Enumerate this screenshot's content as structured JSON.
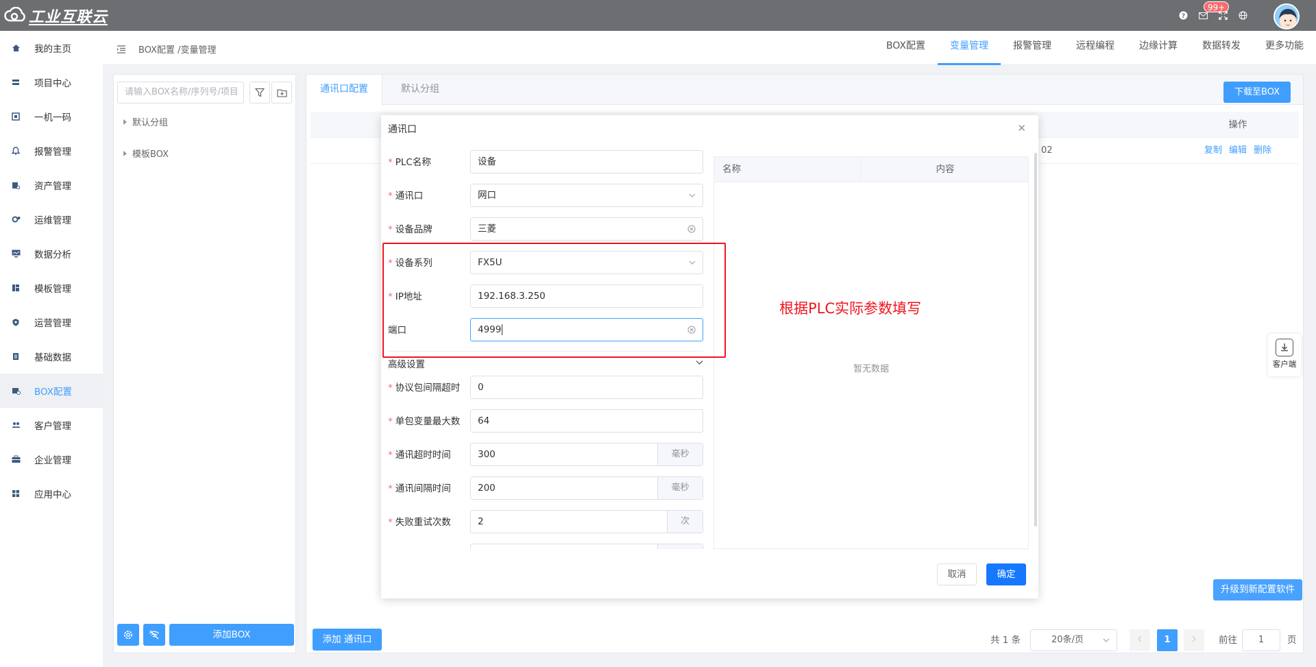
{
  "topbar": {
    "brand": "工业互联云",
    "badge": "99+"
  },
  "sidebar": {
    "items": [
      {
        "label": "我的主页",
        "icon": "home-icon"
      },
      {
        "label": "项目中心",
        "icon": "stack-icon"
      },
      {
        "label": "一机一码",
        "icon": "qr-icon"
      },
      {
        "label": "报警管理",
        "icon": "bell-icon"
      },
      {
        "label": "资产管理",
        "icon": "asset-icon"
      },
      {
        "label": "运维管理",
        "icon": "gear-icon"
      },
      {
        "label": "数据分析",
        "icon": "monitor-icon"
      },
      {
        "label": "模板管理",
        "icon": "template-icon"
      },
      {
        "label": "运营管理",
        "icon": "shield-icon"
      },
      {
        "label": "基础数据",
        "icon": "book-icon"
      },
      {
        "label": "BOX配置",
        "icon": "box-icon"
      },
      {
        "label": "客户管理",
        "icon": "users-icon"
      },
      {
        "label": "企业管理",
        "icon": "briefcase-icon"
      },
      {
        "label": "应用中心",
        "icon": "apps-icon"
      }
    ],
    "active_index": 10
  },
  "header": {
    "breadcrumb": "BOX配置 /变量管理",
    "tabs": [
      "BOX配置",
      "变量管理",
      "报警管理",
      "远程编程",
      "边缘计算",
      "数据转发",
      "更多功能"
    ],
    "active_tab": 1
  },
  "leftpanel": {
    "search_placeholder": "请输入BOX名称/序列号/项目",
    "tree": [
      "默认分组",
      "模板BOX"
    ],
    "add_box": "添加BOX"
  },
  "main": {
    "tabs": [
      "通讯口配置",
      "默认分组"
    ],
    "download_btn": "下载至BOX",
    "table": {
      "col_operation": "操作",
      "row_fragment": "02",
      "ops": [
        "复制",
        "编辑",
        "删除"
      ]
    },
    "add_port": "添加 通讯口",
    "upgrade": "升级到新配置软件",
    "pager": {
      "total": "共 1 条",
      "page_size": "20条/页",
      "current": "1",
      "goto_label": "前往",
      "goto_value": "1",
      "page_unit": "页"
    }
  },
  "client_float": "客户端",
  "modal": {
    "title": "通讯口",
    "fields": [
      {
        "label": "PLC名称",
        "value": "设备",
        "required": true,
        "suffix": ""
      },
      {
        "label": "通讯口",
        "value": "网口",
        "required": true,
        "suffix": "chevron"
      },
      {
        "label": "设备品牌",
        "value": "三菱",
        "required": true,
        "suffix": "clear"
      },
      {
        "label": "设备系列",
        "value": "FX5U",
        "required": true,
        "suffix": "chevron"
      },
      {
        "label": "IP地址",
        "value": "192.168.3.250",
        "required": true,
        "suffix": ""
      },
      {
        "label": "端口",
        "value": "4999",
        "required": false,
        "suffix": "clear"
      }
    ],
    "advanced_label": "高级设置",
    "advanced_fields": [
      {
        "label": "协议包间隔超时",
        "value": "0",
        "unit": ""
      },
      {
        "label": "单包变量最大数",
        "value": "64",
        "unit": ""
      },
      {
        "label": "通讯超时时间",
        "value": "300",
        "unit": "毫秒"
      },
      {
        "label": "通讯间隔时间",
        "value": "200",
        "unit": "毫秒"
      },
      {
        "label": "失败重试次数",
        "value": "2",
        "unit": "次"
      }
    ],
    "right_table": {
      "col_name": "名称",
      "col_content": "内容",
      "empty": "暂无数据"
    },
    "cancel": "取消",
    "ok": "确定"
  },
  "annotation": "根据PLC实际参数填写",
  "colors": {
    "primary": "#409eff",
    "topbar": "#6c6e72",
    "annotation_red": "#f0141e"
  }
}
